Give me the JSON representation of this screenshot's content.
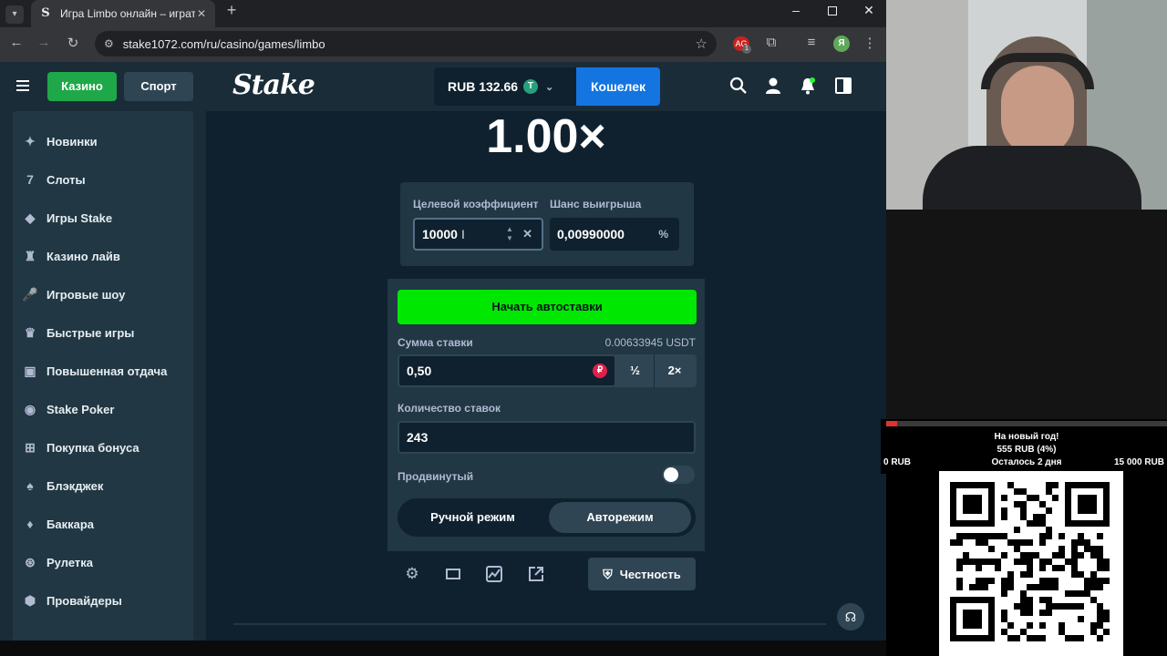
{
  "browser": {
    "tab_title": "Игра Limbo онлайн – играть в",
    "tab_favicon": "S",
    "url": "stake1072.com/ru/casino/games/limbo",
    "profile_letter": "Я",
    "ext_badge": "1"
  },
  "header": {
    "casino_label": "Казино",
    "sport_label": "Спорт",
    "logo_text": "Stake",
    "balance": "RUB 132.66",
    "currency_icon": "T",
    "wallet_label": "Кошелек"
  },
  "sidebar": {
    "items": [
      {
        "label": "Новинки",
        "icon": "sparkle-icon"
      },
      {
        "label": "Слоты",
        "icon": "slots-icon"
      },
      {
        "label": "Игры Stake",
        "icon": "stake-games-icon"
      },
      {
        "label": "Казино лайв",
        "icon": "live-casino-icon"
      },
      {
        "label": "Игровые шоу",
        "icon": "game-show-icon"
      },
      {
        "label": "Быстрые игры",
        "icon": "quick-games-icon"
      },
      {
        "label": "Повышенная отдача",
        "icon": "rtp-icon"
      },
      {
        "label": "Stake Poker",
        "icon": "poker-icon"
      },
      {
        "label": "Покупка бонуса",
        "icon": "gift-icon"
      },
      {
        "label": "Блэкджек",
        "icon": "blackjack-icon"
      },
      {
        "label": "Баккара",
        "icon": "baccarat-icon"
      },
      {
        "label": "Рулетка",
        "icon": "roulette-icon"
      },
      {
        "label": "Провайдеры",
        "icon": "providers-icon"
      }
    ]
  },
  "game": {
    "multiplier": "1.00×",
    "target_label": "Целевой коэффициент",
    "target_value": "10000",
    "chance_label": "Шанс выигрыша",
    "chance_value": "0,00990000",
    "chance_unit": "%",
    "start_button": "Начать автоставки",
    "bet_label": "Сумма ставки",
    "bet_usdt": "0.00633945 USDT",
    "bet_value": "0,50",
    "rub_badge": "₽",
    "half_label": "½",
    "double_label": "2×",
    "count_label": "Количество ставок",
    "count_value": "243",
    "advanced_label": "Продвинутый",
    "advanced_on": false,
    "manual_tab": "Ручной режим",
    "auto_tab": "Авторежим",
    "fairness_label": "Честность"
  },
  "stream": {
    "goal_title": "На новый год!",
    "goal_progress": "555 RUB (4%)",
    "goal_progress_fraction": 0.04,
    "goal_min": "0 RUB",
    "goal_remaining": "Осталось 2 дня",
    "goal_max": "15 000 RUB"
  },
  "colors": {
    "accent_green": "#00e701",
    "wallet_blue": "#1475e1",
    "bg_dark": "#0f212e",
    "panel": "#213743",
    "header": "#1a2c38"
  }
}
